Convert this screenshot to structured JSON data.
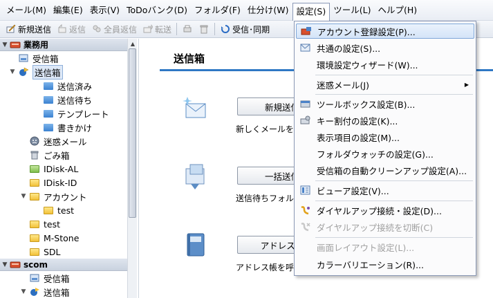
{
  "menubar": {
    "items": [
      {
        "label": "メール(M)"
      },
      {
        "label": "編集(E)"
      },
      {
        "label": "表示(V)"
      },
      {
        "label": "ToDoバンク(D)"
      },
      {
        "label": "フォルダ(F)"
      },
      {
        "label": "仕分け(W)"
      },
      {
        "label": "設定(S)",
        "active": true
      },
      {
        "label": "ツール(L)"
      },
      {
        "label": "ヘルプ(H)"
      }
    ]
  },
  "toolbar": {
    "new_mail": "新規送信",
    "reply": "返信",
    "reply_all": "全員返信",
    "forward": "転送",
    "receive_sync": "受信･同期"
  },
  "sidebar": {
    "accounts": [
      {
        "name": "業務用",
        "nodes": [
          {
            "label": "受信箱",
            "depth": 1,
            "icon": "inbox-icon"
          },
          {
            "label": "送信箱",
            "depth": 1,
            "icon": "outbox-icon",
            "expanded": true,
            "selected": true
          },
          {
            "label": "送信済み",
            "depth": 2,
            "icon": "folder-icon"
          },
          {
            "label": "送信待ち",
            "depth": 2,
            "icon": "folder-icon"
          },
          {
            "label": "テンプレート",
            "depth": 2,
            "icon": "folder-icon"
          },
          {
            "label": "書きかけ",
            "depth": 2,
            "icon": "folder-icon"
          },
          {
            "label": "迷惑メール",
            "depth": 1,
            "icon": "spam-icon"
          },
          {
            "label": "ごみ箱",
            "depth": 1,
            "icon": "trash-icon"
          },
          {
            "label": "IDisk-AL",
            "depth": 1,
            "icon": "folder-green-icon"
          },
          {
            "label": "IDisk-ID",
            "depth": 1,
            "icon": "folder-yellow-icon"
          },
          {
            "label": "アカウント",
            "depth": 1,
            "icon": "folder-yellow-icon",
            "expanded": true
          },
          {
            "label": "test",
            "depth": 2,
            "icon": "folder-yellow-icon"
          },
          {
            "label": "test",
            "depth": 1,
            "icon": "folder-yellow-icon"
          },
          {
            "label": "M-Stone",
            "depth": 1,
            "icon": "folder-yellow-icon"
          },
          {
            "label": "SDL",
            "depth": 1,
            "icon": "folder-yellow-icon"
          }
        ]
      },
      {
        "name": "scom",
        "nodes": [
          {
            "label": "受信箱",
            "depth": 1,
            "icon": "inbox-icon"
          },
          {
            "label": "送信箱",
            "depth": 1,
            "icon": "outbox-icon",
            "expanded": true
          }
        ]
      }
    ]
  },
  "main": {
    "title": "送信箱",
    "actions": [
      {
        "button": "新規送信",
        "desc": "新しくメールを"
      },
      {
        "button": "一括送信",
        "desc": "送信待ちフォル"
      },
      {
        "button": "アドレス帳",
        "desc": "アドレス帳を呼"
      }
    ]
  },
  "settings_menu": {
    "items": [
      {
        "label": "アカウント登録設定(P)...",
        "icon": "account-settings-icon",
        "highlighted": true
      },
      {
        "label": "共通の設定(S)...",
        "icon": "common-settings-icon"
      },
      {
        "label": "環境設定ウィザード(W)..."
      },
      {
        "separator": true
      },
      {
        "label": "迷惑メール(J)",
        "submenu": true
      },
      {
        "separator": true
      },
      {
        "label": "ツールボックス設定(B)...",
        "icon": "toolbox-icon"
      },
      {
        "label": "キー割付の設定(K)...",
        "icon": "key-assign-icon"
      },
      {
        "label": "表示項目の設定(M)..."
      },
      {
        "label": "フォルダウォッチの設定(G)..."
      },
      {
        "label": "受信箱の自動クリーンアップ設定(A)..."
      },
      {
        "separator": true
      },
      {
        "label": "ビューア設定(V)...",
        "icon": "viewer-icon"
      },
      {
        "separator": true
      },
      {
        "label": "ダイヤルアップ接続・設定(D)...",
        "icon": "dialup-icon"
      },
      {
        "label": "ダイヤルアップ接続を切断(C)",
        "icon": "dialup-disconnect-icon",
        "disabled": true
      },
      {
        "separator": true
      },
      {
        "label": "画面レイアウト設定(L)...",
        "disabled": true
      },
      {
        "label": "カラーバリエーション(R)..."
      }
    ]
  }
}
